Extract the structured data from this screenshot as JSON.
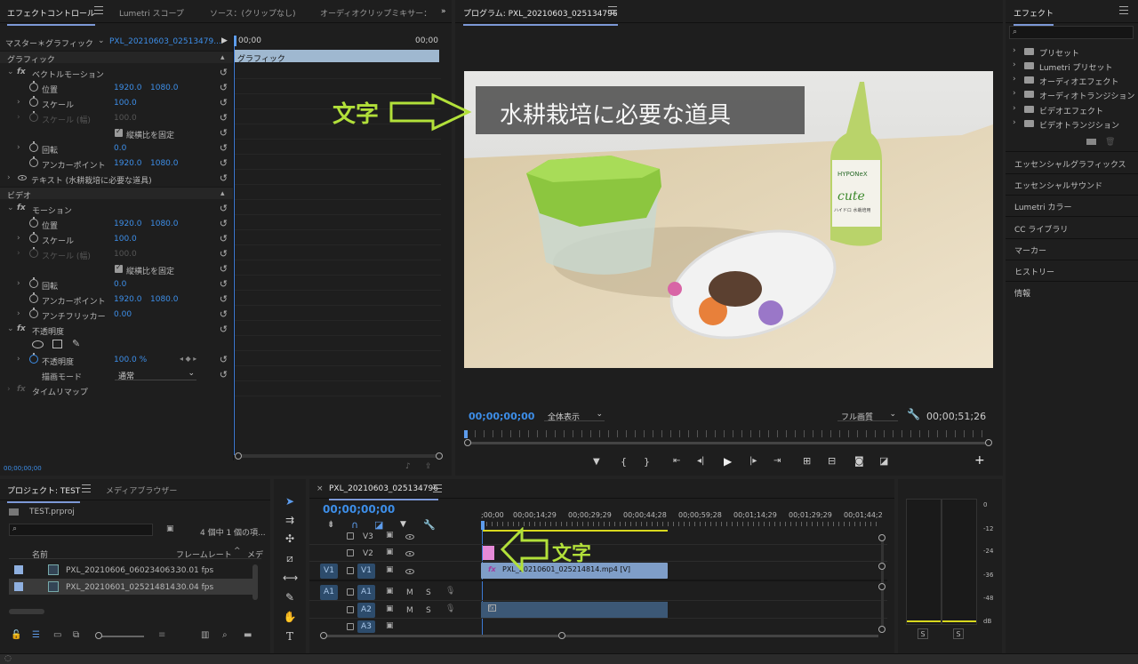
{
  "effect_controls": {
    "tabs": [
      "エフェクトコントロール",
      "Lumetri スコープ",
      "ソース：(クリップなし)",
      "オーディオクリップミキサー："
    ],
    "master": "マスター＊グラフィック",
    "clip": "PXL_20210603_02513479...",
    "tc_start": "00;00",
    "tc_end": "00;00",
    "clip_bar": "グラフィック",
    "section_graphics": "グラフィック",
    "vector_motion": "ベクトルモーション",
    "position": "位置",
    "scale": "スケール",
    "scale_width": "スケール (幅)",
    "uniform_scale": "縦横比を固定",
    "rotation": "回転",
    "anchor": "アンカーポイント",
    "text_layer": "テキスト (水耕栽培に必要な道具)",
    "section_video": "ビデオ",
    "motion": "モーション",
    "antiflicker": "アンチフリッカー",
    "opacity_group": "不透明度",
    "opacity": "不透明度",
    "blend_mode": "描画モード",
    "blend_value": "通常",
    "time_remap": "タイムリマップ",
    "vm_pos_x": "1920.0",
    "vm_pos_y": "1080.0",
    "vm_scale": "100.0",
    "vm_scale_w": "100.0",
    "vm_rot": "0.0",
    "vm_anchor_x": "1920.0",
    "vm_anchor_y": "1080.0",
    "m_pos_x": "1920.0",
    "m_pos_y": "1080.0",
    "m_scale": "100.0",
    "m_scale_w": "100.0",
    "m_rot": "0.0",
    "m_anchor_x": "1920.0",
    "m_anchor_y": "1080.0",
    "m_af": "0.00",
    "opacity_value": "100.0 %",
    "bottom_tc": "00;00;00;00"
  },
  "program": {
    "title": "プログラム: PXL_20210603_025134796",
    "timecode": "00;00;00;00",
    "fit": "全体表示",
    "quality": "フル画質",
    "duration": "00;00;51;26",
    "overlay_title": "水耕栽培に必要な道具",
    "annotation": "文字",
    "bottle_brand": "HYPONeX",
    "bottle_name": "cute",
    "bottle_sub": "ハイドロ 水栽培用"
  },
  "effects": {
    "title": "エフェクト",
    "tree": [
      "プリセット",
      "Lumetri プリセット",
      "オーディオエフェクト",
      "オーディオトランジション",
      "ビデオエフェクト",
      "ビデオトランジション"
    ],
    "panels": [
      "エッセンシャルグラフィックス",
      "エッセンシャルサウンド",
      "Lumetri カラー",
      "CC ライブラリ",
      "マーカー",
      "ヒストリー",
      "情報"
    ]
  },
  "project": {
    "tabs": [
      "プロジェクト: TEST",
      "メディアブラウザー"
    ],
    "file": "TEST.prproj",
    "count": "4 個中 1 個の項...",
    "col_name": "名前",
    "col_fps": "フレームレート",
    "col_more": "メデ",
    "items": [
      {
        "name": "PXL_20210606_060234063.",
        "fps": "30.01 fps"
      },
      {
        "name": "PXL_20210601_025214814.",
        "fps": "30.04 fps"
      }
    ]
  },
  "timeline": {
    "title": "PXL_20210603_025134796",
    "timecode": "00;00;00;00",
    "ruler": [
      ";00;00",
      "00;00;14;29",
      "00;00;29;29",
      "00;00;44;28",
      "00;00;59;28",
      "00;01;14;29",
      "00;01;29;29",
      "00;01;44;2"
    ],
    "tracks_v": [
      "V3",
      "V2",
      "V1"
    ],
    "tracks_a": [
      "A1",
      "A2",
      "A3"
    ],
    "src_v": "V1",
    "src_a": "A1",
    "clip_label": "PXL_20210601_025214814.mp4 [V]",
    "annotation": "文字",
    "m": "M",
    "s": "S"
  },
  "meter": {
    "scale": [
      "0",
      "-12",
      "-24",
      "-36",
      "-48",
      "dB"
    ],
    "s": "S"
  }
}
